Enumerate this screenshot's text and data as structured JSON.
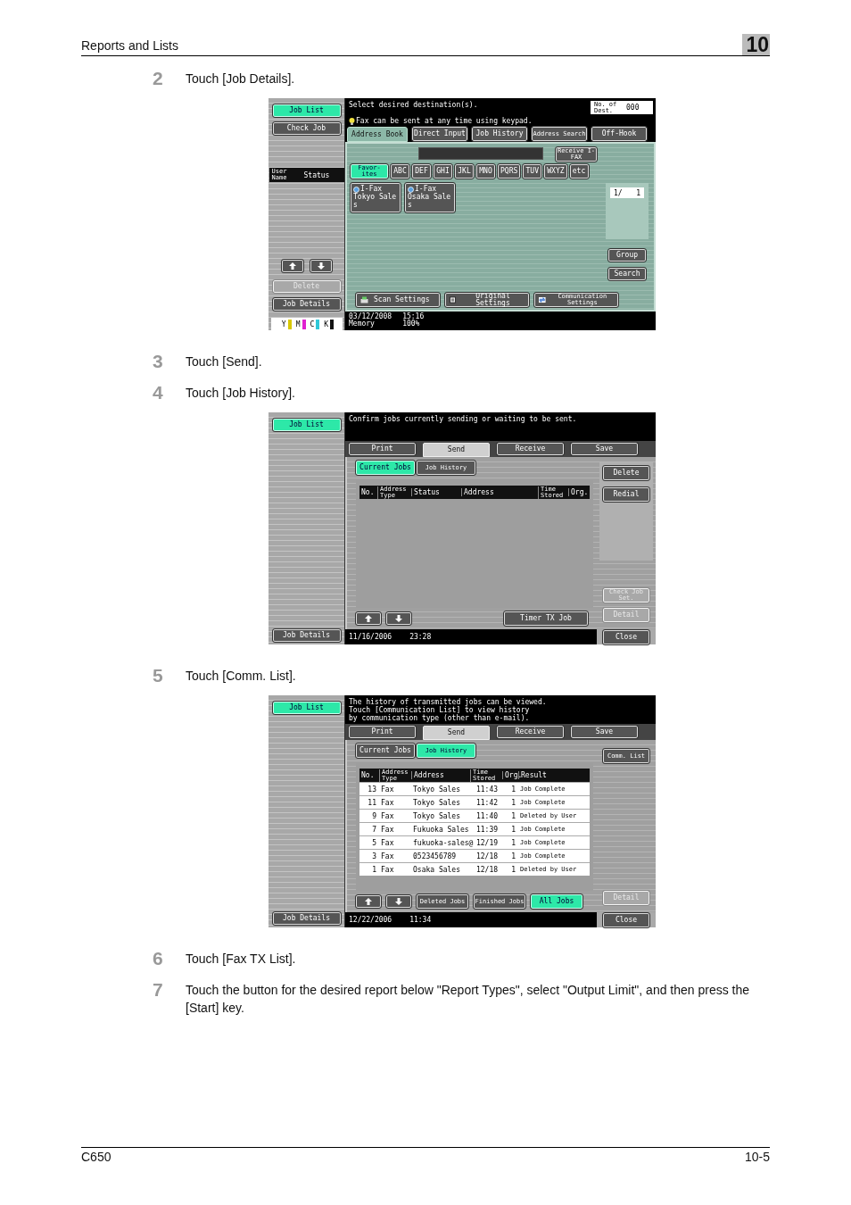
{
  "header": {
    "section": "Reports and Lists",
    "chapter": "10"
  },
  "steps": [
    {
      "number": "2",
      "text": "Touch [Job Details].",
      "screen": {
        "kind": "address_book",
        "sidebar_top": [
          {
            "label": "Job List",
            "selected": true,
            "disabled": false
          },
          {
            "label": "Check Job",
            "selected": false,
            "disabled": false
          }
        ],
        "list_header": [
          {
            "kind": "stacked",
            "label": "User Name"
          },
          {
            "kind": "plain",
            "label": "Status"
          }
        ],
        "sidebar_bottom": [
          {
            "label": "Delete",
            "selected": false,
            "disabled": true
          },
          {
            "label": "Job Details",
            "selected": false,
            "disabled": false
          }
        ],
        "toner": [
          {
            "label": "Y",
            "color": "#d8c800"
          },
          {
            "label": "M",
            "color": "#e020d0"
          },
          {
            "label": "C",
            "color": "#30c8d8"
          },
          {
            "label": "K",
            "color": "#111111"
          }
        ],
        "message": [
          "Select desired destination(s)."
        ],
        "hint": "Fax can be sent at any time using keypad.",
        "dest_count": {
          "label": "No. of Dest.",
          "value": "000"
        },
        "tabs": [
          {
            "kind": "plain",
            "label": "Address Book",
            "selected": true
          },
          {
            "kind": "plain",
            "label": "Direct Input",
            "selected": false
          },
          {
            "kind": "plain",
            "label": "Job History",
            "selected": false
          },
          {
            "kind": "stacked",
            "label": "Address Search",
            "selected": false
          },
          {
            "kind": "plain",
            "label": "Off-Hook",
            "selected": false
          }
        ],
        "receive_button": "Receive I-FAX",
        "index_keys": [
          {
            "kind": "stacked",
            "label": "Favor-ites",
            "selected": true
          },
          {
            "kind": "plain",
            "label": "ABC",
            "selected": false
          },
          {
            "kind": "plain",
            "label": "DEF",
            "selected": false
          },
          {
            "kind": "plain",
            "label": "GHI",
            "selected": false
          },
          {
            "kind": "plain",
            "label": "JKL",
            "selected": false
          },
          {
            "kind": "plain",
            "label": "MNO",
            "selected": false
          },
          {
            "kind": "plain",
            "label": "PQRS",
            "selected": false
          },
          {
            "kind": "plain",
            "label": "TUV",
            "selected": false
          },
          {
            "kind": "plain",
            "label": "WXYZ",
            "selected": false
          },
          {
            "kind": "plain",
            "label": "etc",
            "selected": false
          }
        ],
        "destinations": [
          {
            "type": "I-Fax",
            "name": "Tokyo Sale",
            "extra": "s"
          },
          {
            "type": "I-Fax",
            "name": "Osaka Sale",
            "extra": "s"
          }
        ],
        "page": {
          "current": "1/",
          "total": "1"
        },
        "side_buttons": [
          {
            "kind": "plain",
            "label": "Group",
            "disabled": false
          },
          {
            "kind": "plain",
            "label": "Search",
            "disabled": false
          }
        ],
        "bottom_buttons": [
          {
            "kind": "scan",
            "label": "Scan Settings"
          },
          {
            "kind": "original",
            "label": "Original Settings"
          },
          {
            "kind": "communication",
            "label": "Communication Settings"
          }
        ],
        "status": {
          "date": "03/12/2008",
          "time": "15:16",
          "memory_label": "Memory",
          "memory": "100%"
        }
      }
    },
    {
      "number": "3",
      "text": "Touch [Send]."
    },
    {
      "number": "4",
      "text": "Touch [Job History].",
      "screen": {
        "kind": "job_list",
        "sidebar_top": [
          {
            "label": "Job List",
            "selected": true,
            "disabled": false
          }
        ],
        "sidebar_bottom": [
          {
            "label": "Job Details",
            "selected": false,
            "disabled": false
          }
        ],
        "message": [
          "Confirm jobs currently sending or waiting to be sent."
        ],
        "tabs": [
          {
            "kind": "plain",
            "label": "Print",
            "selected": false
          },
          {
            "kind": "plain",
            "label": "Send",
            "selected": true
          },
          {
            "kind": "plain",
            "label": "Receive",
            "selected": false
          },
          {
            "kind": "plain",
            "label": "Save",
            "selected": false
          }
        ],
        "subtabs": [
          {
            "kind": "plain",
            "label": "Current Jobs",
            "selected": true
          },
          {
            "kind": "stacked",
            "label": "Job History",
            "selected": false
          }
        ],
        "table": {
          "columns": [
            {
              "kind": "plain",
              "label": "No."
            },
            {
              "kind": "stacked",
              "label": "Address Type"
            },
            {
              "kind": "plain",
              "label": "Status"
            },
            {
              "kind": "plain",
              "label": "Address"
            },
            {
              "kind": "stacked",
              "label": "Time Stored"
            },
            {
              "kind": "plain",
              "label": "Org."
            }
          ]
        },
        "side_buttons": [
          {
            "kind": "plain",
            "label": "Delete",
            "disabled": false
          },
          {
            "kind": "plain",
            "label": "Redial",
            "disabled": false
          }
        ],
        "side_buttons_bottom": [
          {
            "kind": "stacked",
            "label": "Check Job Set.",
            "disabled": true
          },
          {
            "kind": "plain",
            "label": "Detail",
            "disabled": true
          }
        ],
        "bottom_buttons": [
          {
            "kind": "up"
          },
          {
            "kind": "down"
          },
          {
            "kind": "plain",
            "label": "Timer TX Job",
            "selected": false
          }
        ],
        "status": {
          "date": "11/16/2006",
          "time": "23:28"
        },
        "close": "Close"
      }
    },
    {
      "number": "5",
      "text": "Touch [Comm. List].",
      "screen": {
        "kind": "job_list",
        "sidebar_top": [
          {
            "label": "Job List",
            "selected": true,
            "disabled": false
          }
        ],
        "sidebar_bottom": [
          {
            "label": "Job Details",
            "selected": false,
            "disabled": false
          }
        ],
        "message": [
          "The history of transmitted jobs can be viewed.",
          "Touch [Communication List] to view history",
          "by communication type (other than e-mail)."
        ],
        "tabs": [
          {
            "kind": "plain",
            "label": "Print",
            "selected": false
          },
          {
            "kind": "plain",
            "label": "Send",
            "selected": true
          },
          {
            "kind": "plain",
            "label": "Receive",
            "selected": false
          },
          {
            "kind": "plain",
            "label": "Save",
            "selected": false
          }
        ],
        "subtabs": [
          {
            "kind": "plain",
            "label": "Current Jobs",
            "selected": false
          },
          {
            "kind": "stacked",
            "label": "Job History",
            "selected": true
          }
        ],
        "table": {
          "columns": [
            {
              "kind": "plain",
              "label": "No."
            },
            {
              "kind": "stacked",
              "label": "Address Type"
            },
            {
              "kind": "plain",
              "label": "Address"
            },
            {
              "kind": "stacked",
              "label": "Time Stored"
            },
            {
              "kind": "plain",
              "label": "Org."
            },
            {
              "kind": "plain",
              "label": "Result"
            }
          ],
          "rows": [
            {
              "cells": [
                "13",
                "Fax",
                "Tokyo Sales",
                "11:43",
                "1",
                "Job Complete"
              ]
            },
            {
              "cells": [
                "11",
                "Fax",
                "Tokyo Sales",
                "11:42",
                "1",
                "Job Complete"
              ]
            },
            {
              "cells": [
                "9",
                "Fax",
                "Tokyo Sales",
                "11:40",
                "1",
                "Deleted by User"
              ]
            },
            {
              "cells": [
                "7",
                "Fax",
                "Fukuoka Sales",
                "11:39",
                "1",
                "Job Complete"
              ]
            },
            {
              "cells": [
                "5",
                "Fax",
                "fukuoka-sales@",
                "12/19",
                "1",
                "Job Complete"
              ]
            },
            {
              "cells": [
                "3",
                "Fax",
                "0523456789",
                "12/18",
                "1",
                "Job Complete"
              ]
            },
            {
              "cells": [
                "1",
                "Fax",
                "Osaka Sales",
                "12/18",
                "1",
                "Deleted by User"
              ]
            }
          ]
        },
        "side_buttons": [
          {
            "kind": "stacked",
            "label": "Comm. List",
            "disabled": false
          }
        ],
        "side_buttons_bottom": [
          {
            "kind": "plain",
            "label": "Detail",
            "disabled": true
          }
        ],
        "bottom_buttons": [
          {
            "kind": "up"
          },
          {
            "kind": "down"
          },
          {
            "kind": "stacked",
            "label": "Deleted Jobs",
            "selected": false
          },
          {
            "kind": "stacked",
            "label": "Finished Jobs",
            "selected": false
          },
          {
            "kind": "plain",
            "label": "All Jobs",
            "selected": true
          }
        ],
        "status": {
          "date": "12/22/2006",
          "time": "11:34"
        },
        "close": "Close"
      }
    },
    {
      "number": "6",
      "text": "Touch [Fax TX List]."
    },
    {
      "number": "7",
      "text": "Touch the button for the desired report below \"Report Types\", select \"Output Limit\", and then press the [Start] key."
    }
  ],
  "footer": {
    "model": "C650",
    "page": "10-5"
  }
}
